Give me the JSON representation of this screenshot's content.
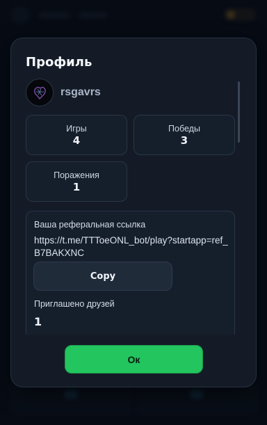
{
  "modal": {
    "title": "Профиль",
    "user": {
      "name": "rsgavrs",
      "avatar_icon": "dark-sketch-avatar"
    },
    "stats": [
      {
        "label": "Игры",
        "value": "4"
      },
      {
        "label": "Победы",
        "value": "3"
      },
      {
        "label": "Поражения",
        "value": "1"
      }
    ],
    "referral": {
      "label": "Ваша реферальная ссылка",
      "link": "https://t.me/TTToeONL_bot/play?startapp=ref_B7BAKXNC",
      "copy_label": "Copy",
      "invited_label": "Приглашено друзей",
      "invited_count": "1"
    },
    "ok_label": "Ок"
  },
  "colors": {
    "background": "#0b111b",
    "modal": "#141b26",
    "card": "#151e2b",
    "ok_button": "#22c55e",
    "coin": "#d39a2a"
  }
}
